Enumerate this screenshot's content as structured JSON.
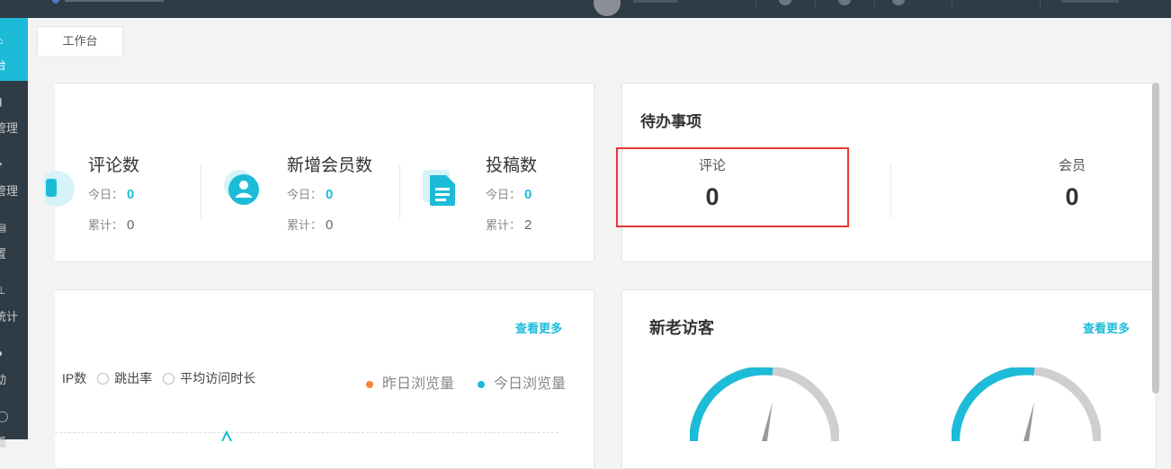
{
  "tab": {
    "label": "工作台"
  },
  "sidebar": {
    "items": [
      {
        "label": "台",
        "icon": "home-icon",
        "active": true
      },
      {
        "label": "管理",
        "icon": "doc-icon"
      },
      {
        "label": "管理",
        "icon": "palette-icon"
      },
      {
        "label": "置",
        "icon": "settings-icon"
      },
      {
        "label": "统计",
        "icon": "chart-icon"
      },
      {
        "label": "动",
        "icon": "user-icon"
      },
      {
        "label": "播",
        "icon": "info-icon"
      }
    ]
  },
  "stats": {
    "today_label": "今日：",
    "total_label": "累计：",
    "items": [
      {
        "title": "评论数",
        "today": "0",
        "total": "0"
      },
      {
        "title": "新增会员数",
        "today": "0",
        "total": "0"
      },
      {
        "title": "投稿数",
        "today": "0",
        "total": "2"
      }
    ]
  },
  "todo": {
    "title": "待办事项",
    "items": [
      {
        "label": "评论",
        "value": "0"
      },
      {
        "label": "会员",
        "value": "0"
      }
    ]
  },
  "traffic": {
    "more": "查看更多",
    "radios": [
      "IP数",
      "跳出率",
      "平均访问时长"
    ],
    "legend": [
      {
        "label": "昨日浏览量",
        "color": "#f5843a"
      },
      {
        "label": "今日浏览量",
        "color": "#1cbcd9"
      }
    ]
  },
  "visitors": {
    "title": "新老访客",
    "more": "查看更多"
  },
  "colors": {
    "accent": "#1cbcd9",
    "highlight": "#e53935",
    "dark": "#2f3b45"
  }
}
